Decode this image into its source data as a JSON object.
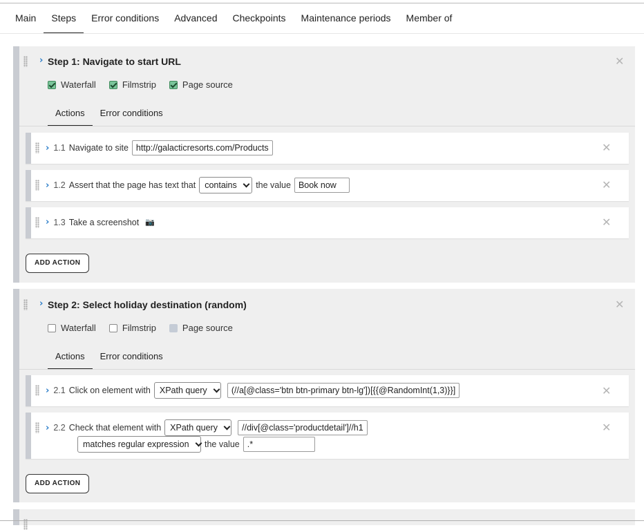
{
  "tabs": [
    "Main",
    "Steps",
    "Error conditions",
    "Advanced",
    "Checkpoints",
    "Maintenance periods",
    "Member of"
  ],
  "active_tab": "Steps",
  "steps": [
    {
      "title": "Step 1: Navigate to start URL",
      "options": [
        {
          "label": "Waterfall",
          "state": "checked"
        },
        {
          "label": "Filmstrip",
          "state": "checked"
        },
        {
          "label": "Page source",
          "state": "checked"
        }
      ],
      "subtabs": [
        "Actions",
        "Error conditions"
      ],
      "actions": [
        {
          "num": "1.1",
          "text": "Navigate to site",
          "url": "http://galacticresorts.com/Products"
        },
        {
          "num": "1.2",
          "text": "Assert that the page has text that",
          "operator": "contains",
          "text2": "the value",
          "value": "Book now"
        },
        {
          "num": "1.3",
          "text": "Take a screenshot",
          "icon": "camera-icon",
          "icon_glyph": "📷"
        }
      ],
      "add_label": "ADD ACTION"
    },
    {
      "title": "Step 2: Select holiday destination (random)",
      "options": [
        {
          "label": "Waterfall",
          "state": "unchecked"
        },
        {
          "label": "Filmstrip",
          "state": "unchecked"
        },
        {
          "label": "Page source",
          "state": "disabled"
        }
      ],
      "subtabs": [
        "Actions",
        "Error conditions"
      ],
      "actions": [
        {
          "num": "2.1",
          "text": "Click on element with",
          "selector_type": "XPath query",
          "selector": "(//a[@class='btn btn-primary btn-lg'])[{{@RandomInt(1,3)}}]"
        },
        {
          "num": "2.2",
          "text": "Check that element with",
          "selector_type": "XPath query",
          "selector": "//div[@class='productdetail']//h1",
          "operator": "matches regular expression",
          "text2": "the value",
          "value": ".*"
        }
      ],
      "add_label": "ADD ACTION"
    }
  ],
  "icons": {
    "chevron": "›",
    "close": "✕"
  },
  "colors": {
    "accent": "#2a7dc9",
    "checkbox_checked": "#7ac49a",
    "step_bar": "#c9ccd2"
  }
}
